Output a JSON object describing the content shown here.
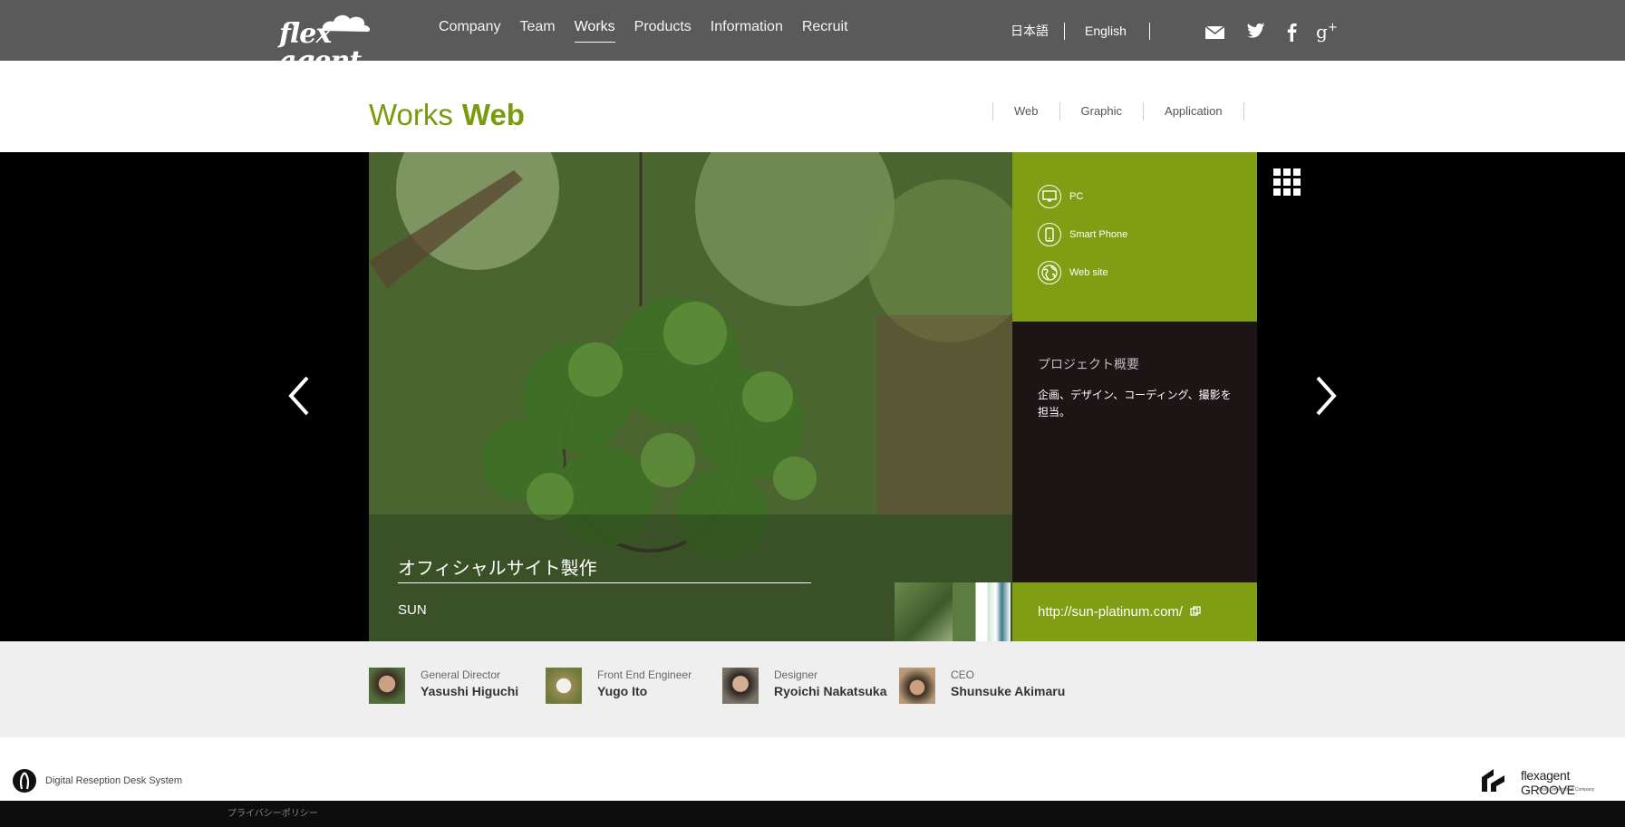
{
  "header": {
    "logo_text": "flex agent",
    "nav": [
      {
        "label": "Company",
        "active": false
      },
      {
        "label": "Team",
        "active": false
      },
      {
        "label": "Works",
        "active": true
      },
      {
        "label": "Products",
        "active": false
      },
      {
        "label": "Information",
        "active": false
      },
      {
        "label": "Recruit",
        "active": false
      }
    ],
    "lang_ja": "日本語",
    "lang_en": "English",
    "social_icons": [
      "mail-icon",
      "twitter-icon",
      "facebook-icon",
      "google-plus-icon"
    ]
  },
  "page_title": {
    "main": "Works",
    "sub": "Web"
  },
  "category_nav": [
    "Web",
    "Graphic",
    "Application"
  ],
  "work": {
    "title": "オフィシャルサイト製作",
    "client": "SUN",
    "links": [
      {
        "label": "PC",
        "icon": "monitor-icon"
      },
      {
        "label": "Smart Phone",
        "icon": "smartphone-icon"
      },
      {
        "label": "Web site",
        "icon": "globe-icon"
      }
    ],
    "overview_title": "プロジェクト概要",
    "overview_text": "企画、デザイン、コーディング、撮影を担当。",
    "url": "http://sun-platinum.com/"
  },
  "team": [
    {
      "role": "General Director",
      "name": "Yasushi Higuchi"
    },
    {
      "role": "Front End Engineer",
      "name": "Yugo Ito"
    },
    {
      "role": "Designer",
      "name": "Ryoichi Nakatsuka"
    },
    {
      "role": "CEO",
      "name": "Shunsuke Akimaru"
    }
  ],
  "footer": {
    "drd_label": "Digital Reseption Desk System",
    "groove_name": "flexagent GROOVE",
    "groove_sub": "Multi Dimentional Company",
    "privacy": "プライバシーポリシー"
  },
  "colors": {
    "accent_green": "#809e13",
    "title_green": "#7a9a10",
    "header_gray": "#5a5a5a"
  }
}
